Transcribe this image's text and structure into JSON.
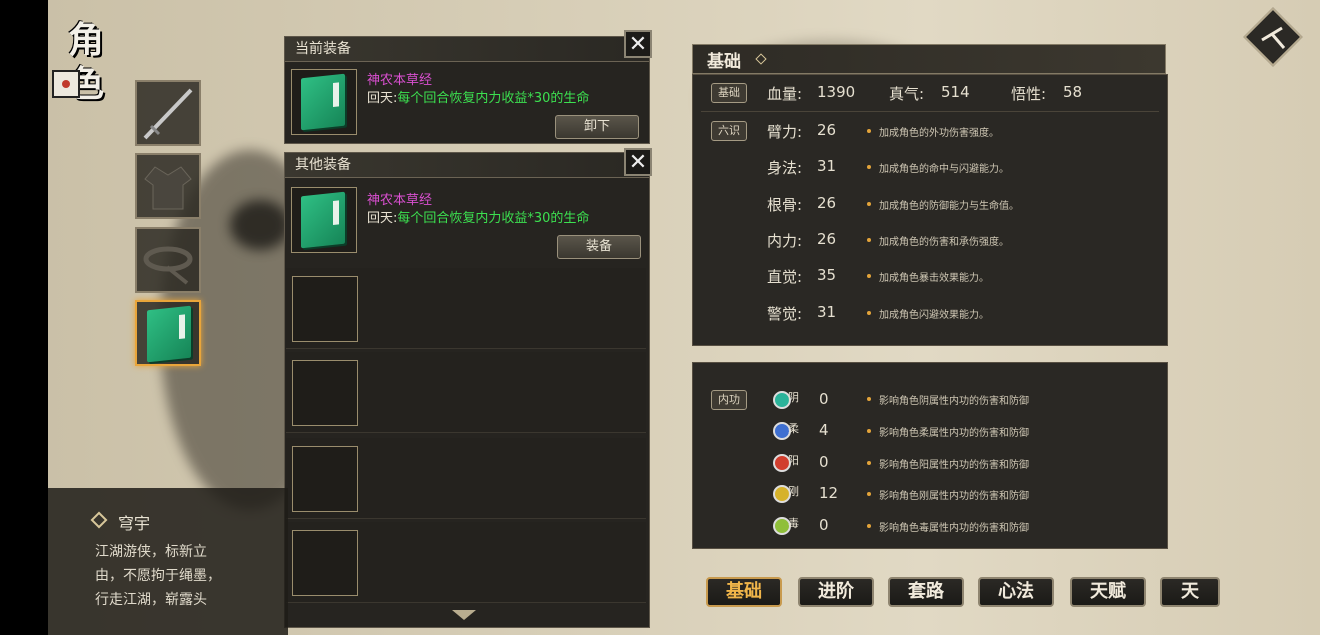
{
  "screen_title": "角色",
  "colors": {
    "accent_gold": "#e9a53a",
    "item_name": "#d94fd0",
    "item_effect": "#3ce050",
    "panel_bg": "#262420"
  },
  "equipment_slots": [
    {
      "icon": "sword-icon",
      "selected": false
    },
    {
      "icon": "robe-icon",
      "selected": false
    },
    {
      "icon": "belt-icon",
      "selected": false
    },
    {
      "icon": "green-book-icon",
      "selected": true
    }
  ],
  "current_equipment": {
    "header": "当前装备",
    "item": {
      "name": "神农本草经",
      "effect_prefix": "回天:",
      "effect": "每个回合恢复内力收益*30的生命"
    },
    "button": "卸下"
  },
  "other_equipment": {
    "header": "其他装备",
    "items": [
      {
        "name": "神农本草经",
        "effect_prefix": "回天:",
        "effect": "每个回合恢复内力收益*30的生命",
        "button": "装备"
      }
    ]
  },
  "basic": {
    "header": "基础",
    "tag": "基础",
    "stats": [
      {
        "label": "血量:",
        "value": "1390"
      },
      {
        "label": "真气:",
        "value": "514"
      },
      {
        "label": "悟性:",
        "value": "58"
      }
    ],
    "six_tag": "六识",
    "six": [
      {
        "label": "臂力:",
        "value": "26",
        "desc": "加成角色的外功伤害强度。"
      },
      {
        "label": "身法:",
        "value": "31",
        "desc": "加成角色的命中与闪避能力。"
      },
      {
        "label": "根骨:",
        "value": "26",
        "desc": "加成角色的防御能力与生命值。"
      },
      {
        "label": "内力:",
        "value": "26",
        "desc": "加成角色的伤害和承伤强度。"
      },
      {
        "label": "直觉:",
        "value": "35",
        "desc": "加成角色暴击效果能力。"
      },
      {
        "label": "警觉:",
        "value": "31",
        "desc": "加成角色闪避效果能力。"
      }
    ]
  },
  "neigong": {
    "tag": "内功",
    "items": [
      {
        "char": "阴",
        "value": "0",
        "desc": "影响角色阴属性内功的伤害和防御",
        "color": "#2bb39a"
      },
      {
        "char": "柔",
        "value": "4",
        "desc": "影响角色柔属性内功的伤害和防御",
        "color": "#3e6fd1"
      },
      {
        "char": "阳",
        "value": "0",
        "desc": "影响角色阳属性内功的伤害和防御",
        "color": "#d13e2e"
      },
      {
        "char": "刚",
        "value": "12",
        "desc": "影响角色刚属性内功的伤害和防御",
        "color": "#d6b22b"
      },
      {
        "char": "毒",
        "value": "0",
        "desc": "影响角色毒属性内功的伤害和防御",
        "color": "#8fbf3a"
      }
    ]
  },
  "character": {
    "name": "穹宇",
    "bio_lines": [
      "江湖游侠，标新立",
      "由，不愿拘于绳墨，",
      "行走江湖，崭露头"
    ]
  },
  "tabs": [
    "基础",
    "进阶",
    "套路",
    "心法",
    "天赋",
    "天"
  ]
}
